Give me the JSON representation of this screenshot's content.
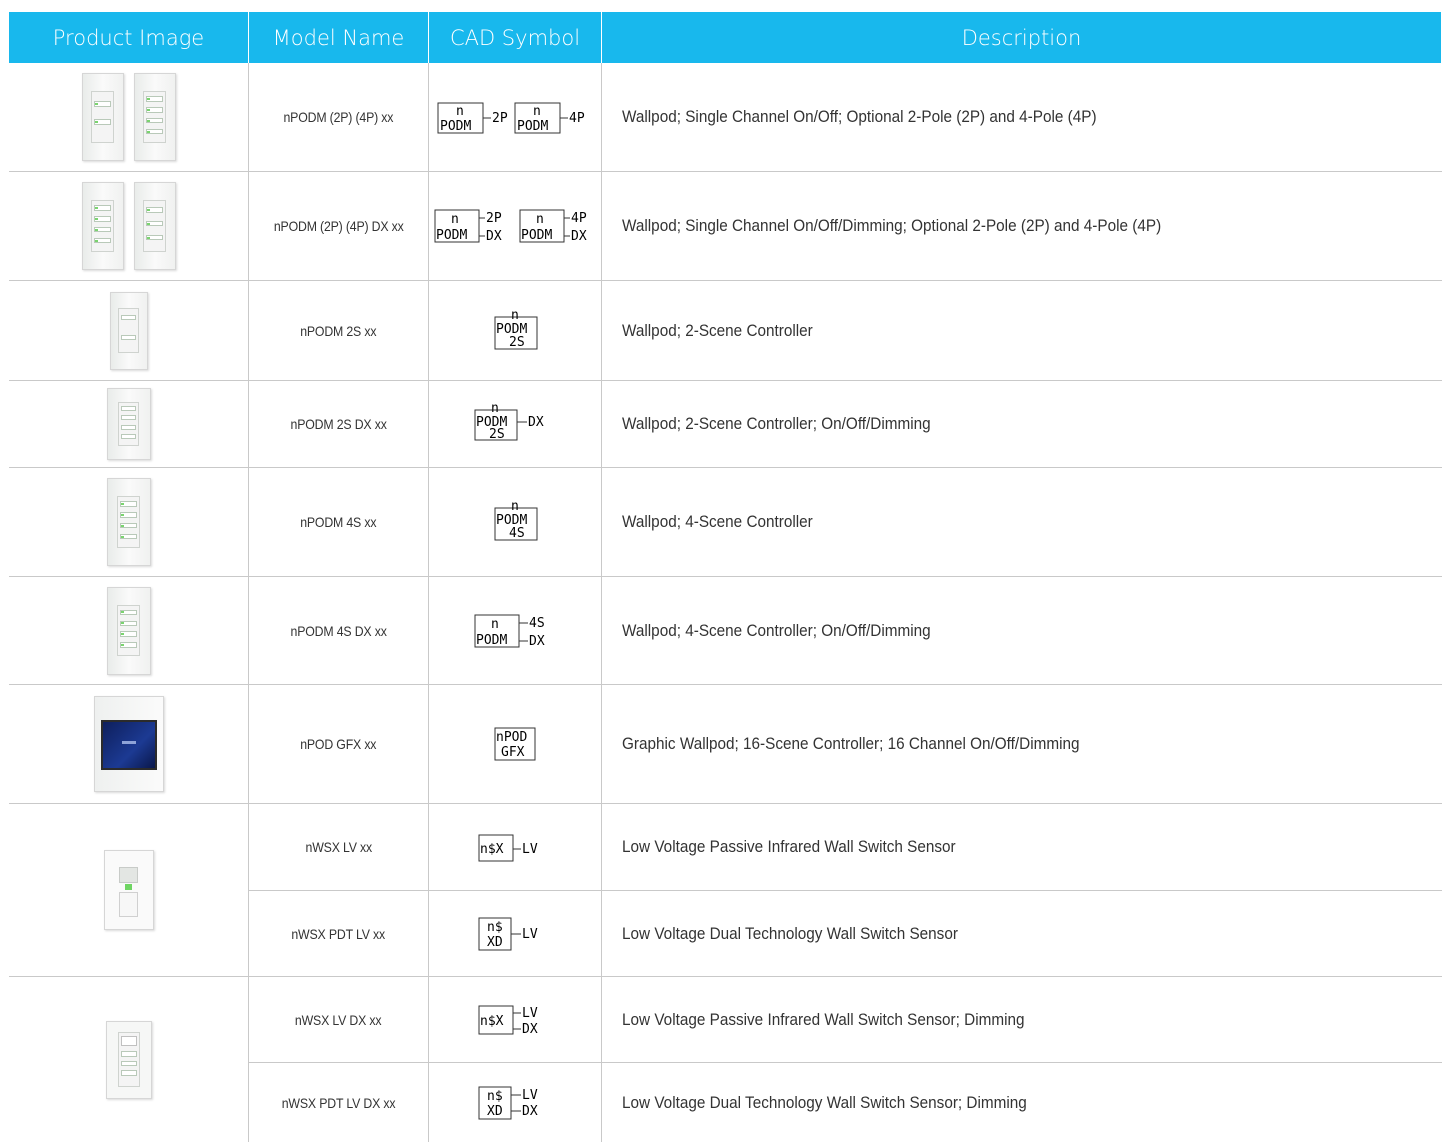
{
  "header": {
    "product_image": "Product Image",
    "model_name": "Model Name",
    "cad_symbol": "CAD Symbol",
    "description": "Description"
  },
  "rows": [
    {
      "model": "nPODM (2P) (4P) xx",
      "description": "Wallpod; Single Channel On/Off; Optional 2-Pole (2P) and 4-Pole (4P)",
      "cad": [
        "n",
        "PODM",
        "2P",
        "n",
        "PODM",
        "4P"
      ]
    },
    {
      "model": "nPODM (2P) (4P) DX xx",
      "description": "Wallpod; Single Channel On/Off/Dimming; Optional 2-Pole (2P) and 4-Pole (4P)",
      "cad": [
        "n",
        "PODM",
        "2P",
        "DX",
        "n",
        "PODM",
        "4P",
        "DX"
      ]
    },
    {
      "model": "nPODM 2S xx",
      "description": "Wallpod; 2-Scene Controller",
      "cad": [
        "n",
        "PODM",
        "2S"
      ]
    },
    {
      "model": "nPODM 2S DX xx",
      "description": "Wallpod; 2-Scene Controller; On/Off/Dimming",
      "cad": [
        "n",
        "PODM",
        "2S",
        "DX"
      ]
    },
    {
      "model": "nPODM 4S xx",
      "description": "Wallpod; 4-Scene Controller",
      "cad": [
        "n",
        "PODM",
        "4S"
      ]
    },
    {
      "model": "nPODM 4S DX xx",
      "description": "Wallpod; 4-Scene Controller; On/Off/Dimming",
      "cad": [
        "n",
        "PODM",
        "4S",
        "DX"
      ]
    },
    {
      "model": "nPOD GFX xx",
      "description": "Graphic Wallpod; 16-Scene Controller; 16 Channel On/Off/Dimming",
      "cad": [
        "nPOD",
        "GFX"
      ]
    },
    {
      "model": "nWSX LV xx",
      "description": "Low Voltage Passive Infrared Wall Switch Sensor",
      "cad": [
        "n$X",
        "LV"
      ]
    },
    {
      "model": "nWSX PDT LV xx",
      "description": "Low Voltage Dual Technology Wall Switch Sensor",
      "cad": [
        "n$",
        "XD",
        "LV"
      ]
    },
    {
      "model": "nWSX LV DX xx",
      "description": "Low Voltage Passive Infrared Wall Switch Sensor; Dimming",
      "cad": [
        "n$X",
        "LV",
        "DX"
      ]
    },
    {
      "model": "nWSX PDT LV DX xx",
      "description": "Low Voltage Dual Technology Wall Switch Sensor; Dimming",
      "cad": [
        "n$",
        "XD",
        "LV",
        "DX"
      ]
    }
  ],
  "colors": {
    "header_bg": "#18b8ed",
    "header_text": "#ffffff",
    "grid_line": "#c9c9c9",
    "led_green": "#7ad46f"
  }
}
